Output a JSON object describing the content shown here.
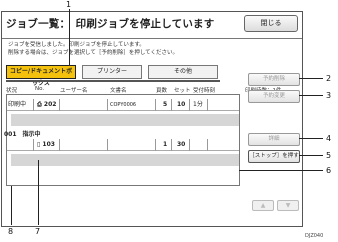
{
  "header": {
    "title": "ジョブ一覧：　印刷ジョブを停止しています",
    "close_label": "閉じる"
  },
  "message": {
    "line1": "ジョブを受信しました。印刷ジョブを停止しています。",
    "line2": "削除する場合は、ジョブを選択して［予約削除］を押してください。"
  },
  "tabs": [
    {
      "label": "コピー/ドキュメントボックス",
      "active": true
    },
    {
      "label": "プリンター",
      "active": false
    },
    {
      "label": "その他",
      "active": false
    }
  ],
  "columns": {
    "status": "状況",
    "no": "No.",
    "user": "ユーザー名",
    "doc": "文書名",
    "pages": "頁数",
    "sets": "セット",
    "time": "受付時刻",
    "total_prints": "印刷待数：1件"
  },
  "printing_row": {
    "status": "印刷中",
    "no": "202",
    "doc": "COPY0006",
    "pages": "5",
    "sets": "10",
    "time": "1分"
  },
  "queue_label": "001　指示中",
  "queued_row": {
    "no": "103",
    "pages": "1",
    "sets": "30"
  },
  "side_buttons": {
    "btn2": "予約削除",
    "btn3": "予約変更",
    "btn4": "詳細",
    "btn5": "［ストップ］を押してください",
    "btn5_short": "［ストップ］を押す"
  },
  "nav": {
    "up": "▲",
    "down": "▼"
  },
  "callouts": [
    "1",
    "2",
    "3",
    "4",
    "5",
    "6",
    "7",
    "8"
  ],
  "image_id": "DJZ040"
}
